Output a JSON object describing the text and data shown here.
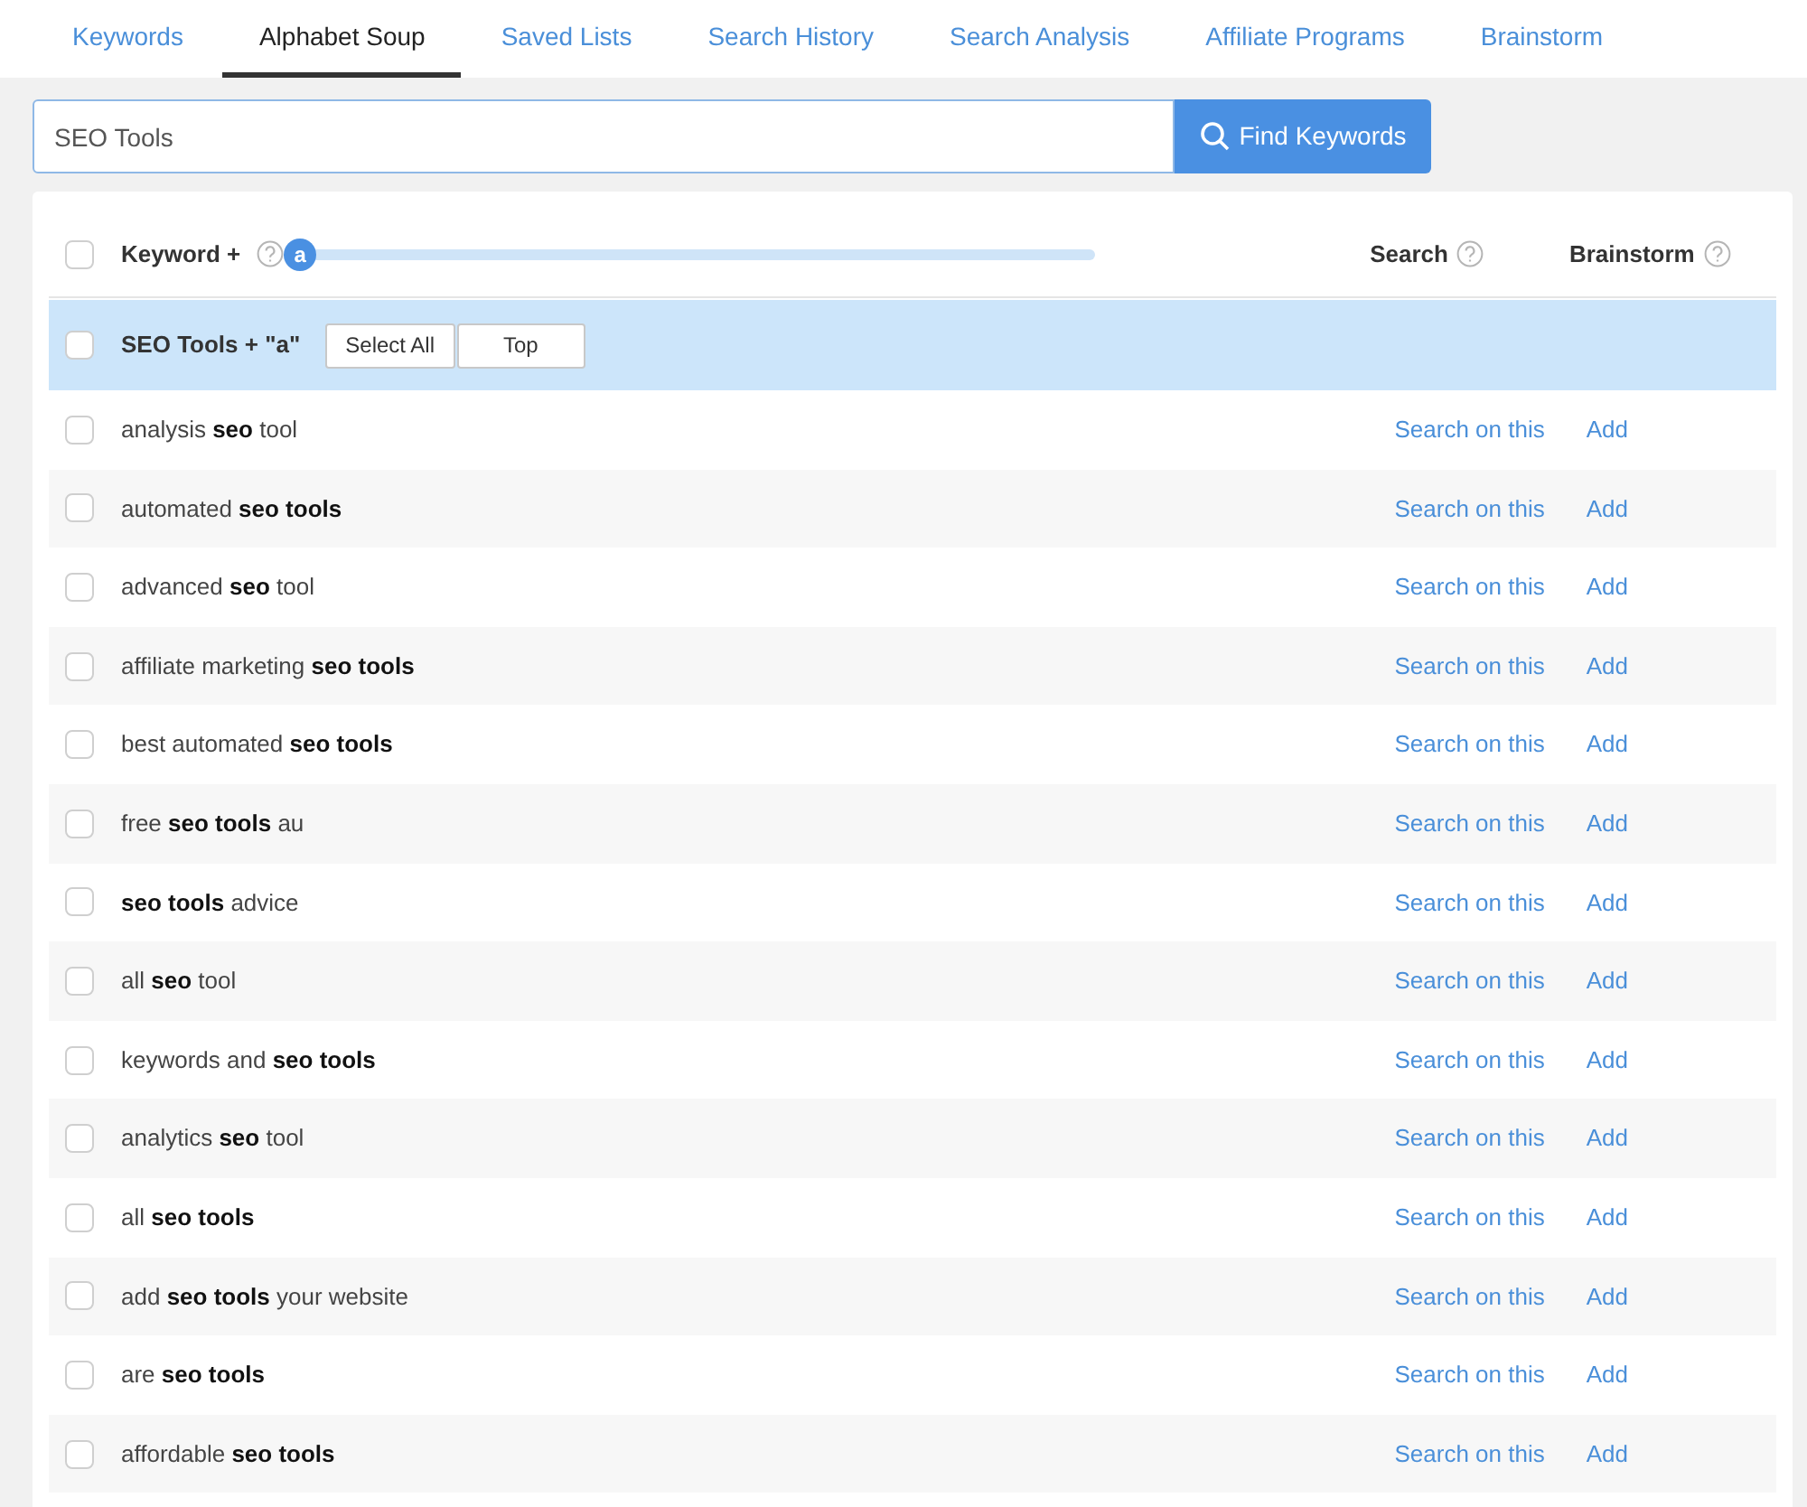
{
  "tabs": [
    {
      "label": "Keywords",
      "selected": false
    },
    {
      "label": "Alphabet Soup",
      "selected": true
    },
    {
      "label": "Saved Lists",
      "selected": false
    },
    {
      "label": "Search History",
      "selected": false
    },
    {
      "label": "Search Analysis",
      "selected": false
    },
    {
      "label": "Affiliate Programs",
      "selected": false
    },
    {
      "label": "Brainstorm",
      "selected": false
    }
  ],
  "search": {
    "value": "SEO Tools",
    "button": "Find Keywords"
  },
  "table": {
    "header": {
      "checked": false,
      "keyword": "Keyword +",
      "slider": {
        "letter": "a",
        "level": 0
      },
      "search": "Search",
      "brainstorm": "Brainstorm"
    },
    "group": {
      "checked": false,
      "label": "SEO Tools + \"a\"",
      "buttons": [
        "Select All",
        "Top"
      ]
    },
    "rows": [
      {
        "keyword": "analysis **seo** tool",
        "checked": false,
        "search": "Search on this",
        "add": "Add"
      },
      {
        "keyword": "automated **seo tools**",
        "checked": false,
        "search": "Search on this",
        "add": "Add"
      },
      {
        "keyword": "advanced **seo** tool",
        "checked": false,
        "search": "Search on this",
        "add": "Add"
      },
      {
        "keyword": "affiliate marketing **seo tools**",
        "checked": false,
        "search": "Search on this",
        "add": "Add"
      },
      {
        "keyword": "best automated **seo tools**",
        "checked": false,
        "search": "Search on this",
        "add": "Add"
      },
      {
        "keyword": "free **seo tools** au",
        "checked": false,
        "search": "Search on this",
        "add": "Add"
      },
      {
        "keyword": "**seo tools** advice",
        "checked": false,
        "search": "Search on this",
        "add": "Add"
      },
      {
        "keyword": "all **seo** tool",
        "checked": false,
        "search": "Search on this",
        "add": "Add"
      },
      {
        "keyword": "keywords and **seo tools**",
        "checked": false,
        "search": "Search on this",
        "add": "Add"
      },
      {
        "keyword": "analytics **seo** tool",
        "checked": false,
        "search": "Search on this",
        "add": "Add"
      },
      {
        "keyword": "all **seo tools**",
        "checked": false,
        "search": "Search on this",
        "add": "Add"
      },
      {
        "keyword": "add **seo tools** your website",
        "checked": false,
        "search": "Search on this",
        "add": "Add"
      },
      {
        "keyword": "are **seo tools**",
        "checked": false,
        "search": "Search on this",
        "add": "Add"
      },
      {
        "keyword": "affordable **seo tools**",
        "checked": false,
        "search": "Search on this",
        "add": "Add"
      }
    ]
  }
}
